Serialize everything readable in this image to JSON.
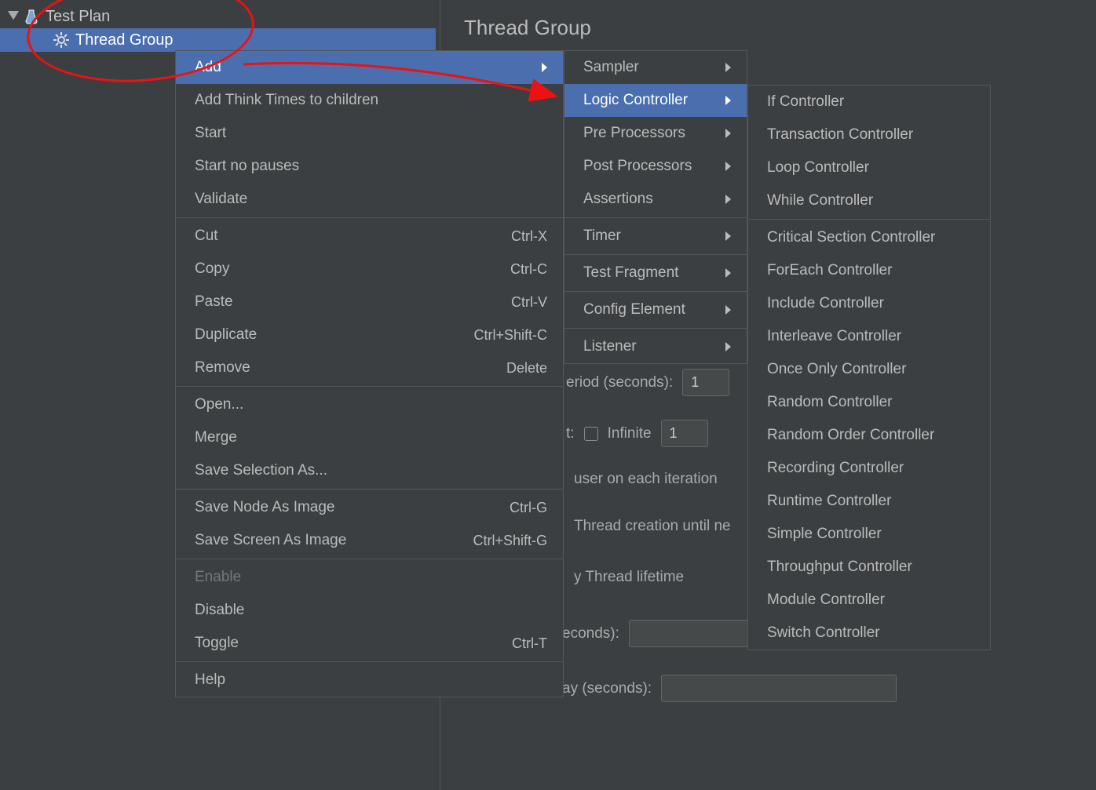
{
  "tree": {
    "root": "Test Plan",
    "child": "Thread Group"
  },
  "panel_title": "Thread Group",
  "context_menu": {
    "items": [
      {
        "label": "Add",
        "submenu": true,
        "highlight": true
      },
      {
        "label": "Add Think Times to children"
      },
      {
        "label": "Start"
      },
      {
        "label": "Start no pauses"
      },
      {
        "label": "Validate"
      },
      {
        "sep": true
      },
      {
        "label": "Cut",
        "shortcut": "Ctrl-X"
      },
      {
        "label": "Copy",
        "shortcut": "Ctrl-C"
      },
      {
        "label": "Paste",
        "shortcut": "Ctrl-V"
      },
      {
        "label": "Duplicate",
        "shortcut": "Ctrl+Shift-C"
      },
      {
        "label": "Remove",
        "shortcut": "Delete"
      },
      {
        "sep": true
      },
      {
        "label": "Open..."
      },
      {
        "label": "Merge"
      },
      {
        "label": "Save Selection As..."
      },
      {
        "sep": true
      },
      {
        "label": "Save Node As Image",
        "shortcut": "Ctrl-G"
      },
      {
        "label": "Save Screen As Image",
        "shortcut": "Ctrl+Shift-G"
      },
      {
        "sep": true
      },
      {
        "label": "Enable",
        "disabled": true
      },
      {
        "label": "Disable"
      },
      {
        "label": "Toggle",
        "shortcut": "Ctrl-T"
      },
      {
        "sep": true
      },
      {
        "label": "Help"
      }
    ]
  },
  "add_submenu": {
    "items": [
      {
        "label": "Sampler",
        "submenu": true
      },
      {
        "label": "Logic Controller",
        "submenu": true,
        "highlight": true
      },
      {
        "label": "Pre Processors",
        "submenu": true
      },
      {
        "label": "Post Processors",
        "submenu": true
      },
      {
        "label": "Assertions",
        "submenu": true
      },
      {
        "sep": true
      },
      {
        "label": "Timer",
        "submenu": true
      },
      {
        "sep": true
      },
      {
        "label": "Test Fragment",
        "submenu": true
      },
      {
        "sep": true
      },
      {
        "label": "Config Element",
        "submenu": true
      },
      {
        "sep": true
      },
      {
        "label": "Listener",
        "submenu": true
      }
    ]
  },
  "logic_submenu": {
    "items": [
      {
        "label": "If Controller"
      },
      {
        "label": "Transaction Controller"
      },
      {
        "label": "Loop Controller"
      },
      {
        "label": "While Controller"
      },
      {
        "sep": true
      },
      {
        "label": "Critical Section Controller"
      },
      {
        "label": "ForEach Controller"
      },
      {
        "label": "Include Controller"
      },
      {
        "label": "Interleave Controller"
      },
      {
        "label": "Once Only Controller"
      },
      {
        "label": "Random Controller"
      },
      {
        "label": "Random Order Controller"
      },
      {
        "label": "Recording Controller"
      },
      {
        "label": "Runtime Controller"
      },
      {
        "label": "Simple Controller"
      },
      {
        "label": "Throughput Controller"
      },
      {
        "label": "Module Controller"
      },
      {
        "label": "Switch Controller"
      }
    ]
  },
  "bg": {
    "period_label": "eriod (seconds):",
    "period_value": "1",
    "infinite_label": "Infinite",
    "infinite_suffix": "t:",
    "loop_value": "1",
    "same_user": "user on each iteration",
    "delay_thread": "Thread creation until ne",
    "specify_lifetime": "y Thread lifetime",
    "duration_label": "econds):",
    "delay_label": "ay (seconds):"
  }
}
